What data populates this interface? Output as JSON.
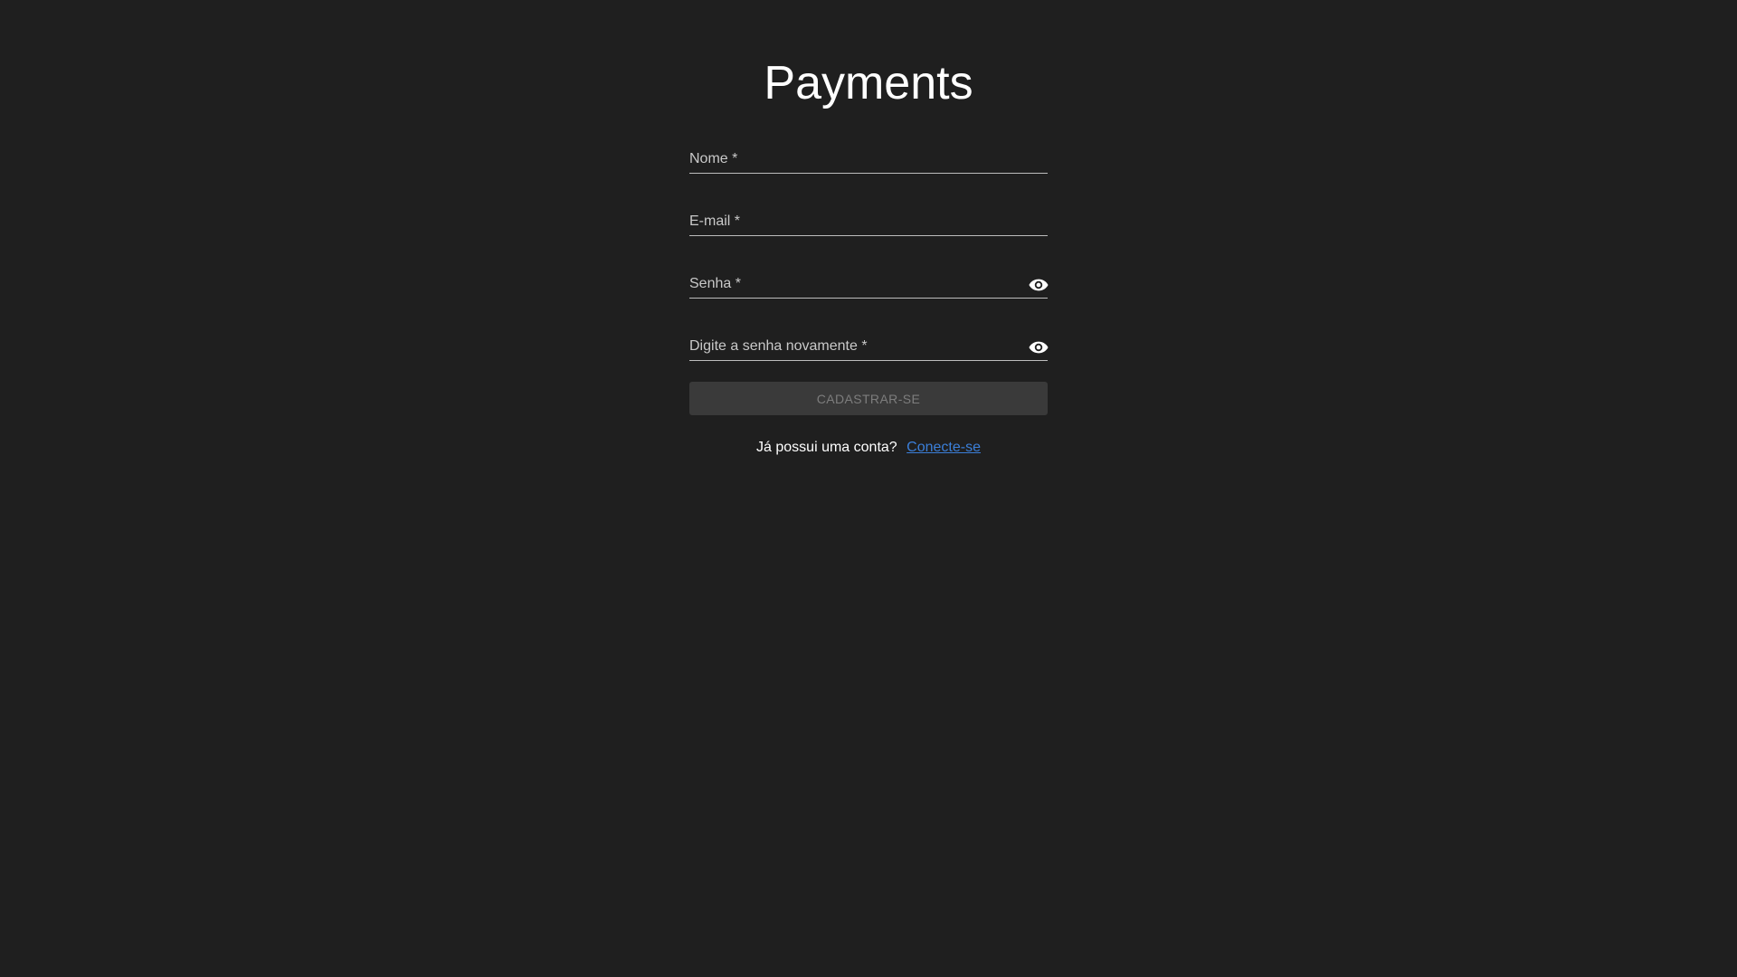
{
  "app": {
    "title": "Payments"
  },
  "form": {
    "name_field": {
      "label": "Nome *",
      "value": ""
    },
    "email_field": {
      "label": "E-mail *",
      "value": ""
    },
    "password_field": {
      "label": "Senha *",
      "value": "",
      "toggle_icon": "eye-icon"
    },
    "confirm_password_field": {
      "label": "Digite a senha novamente *",
      "value": "",
      "toggle_icon": "eye-icon"
    },
    "submit_label": "CADASTRAR-SE"
  },
  "footer": {
    "question": "Já possui uma conta?",
    "login_link": "Conecte-se"
  },
  "colors": {
    "background": "#1f1f1f",
    "link": "#3b7fd9",
    "button_disabled_bg": "#3a3a3a",
    "button_disabled_text": "#7d7d7d"
  }
}
